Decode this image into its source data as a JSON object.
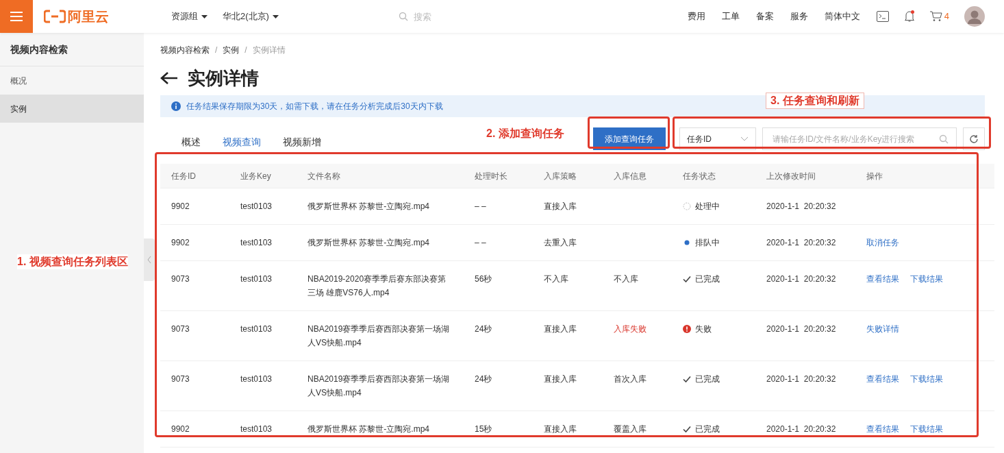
{
  "topbar": {
    "brand": "阿里云",
    "menus": [
      {
        "label": "资源组"
      },
      {
        "label": "华北2(北京)"
      }
    ],
    "search": {
      "placeholder": "搜索"
    },
    "links": [
      "费用",
      "工单",
      "备案",
      "服务",
      "简体中文"
    ],
    "notification_dot": true,
    "cart_count": "4"
  },
  "sidebar": {
    "title": "视频内容检索",
    "items": [
      {
        "label": "概况",
        "selected": false
      },
      {
        "label": "实例",
        "selected": true
      }
    ]
  },
  "breadcrumb": [
    "视频内容检索",
    "实例",
    "实例详情"
  ],
  "breadcrumb_separator": "/",
  "page_title": "实例详情",
  "notice": "任务结果保存期限为30天，如需下载，请在任务分析完成后30天内下载",
  "tabs": [
    {
      "label": "概述",
      "selected": false
    },
    {
      "label": "视频查询",
      "selected": true
    },
    {
      "label": "视频新增",
      "selected": false
    }
  ],
  "add_button": "添加查询任务",
  "filter_select": "任务ID",
  "search_field": {
    "placeholder": "请输任务ID/文件名称/业务Key进行搜索"
  },
  "table": {
    "columns": [
      "任务ID",
      "业务Key",
      "文件名称",
      "处理时长",
      "入库策略",
      "入库信息",
      "任务状态",
      "上次修改时间",
      "操作"
    ],
    "rows": [
      {
        "id": "9902",
        "key": "test0103",
        "file": "俄罗斯世界杯 苏黎世-立陶宛.mp4",
        "duration": "– –",
        "policy": "直接入库",
        "status": {
          "kind": "processing",
          "label": "处理中"
        },
        "modified": "2020-1-1  20:20:32"
      },
      {
        "id": "9902",
        "key": "test0103",
        "file": "俄罗斯世界杯 苏黎世-立陶宛.mp4",
        "duration": "– –",
        "policy": "去重入库",
        "status": {
          "kind": "queued",
          "label": "排队中"
        },
        "modified": "2020-1-1  20:20:32",
        "actions": [
          "取消任务"
        ]
      },
      {
        "id": "9073",
        "key": "test0103",
        "file": "NBA2019-2020赛季季后赛东部决赛第三场 雄鹿VS76人.mp4",
        "duration": "56秒",
        "policy": "不入库",
        "info": {
          "text": "不入库",
          "failed": false
        },
        "status": {
          "kind": "done",
          "label": "已完成"
        },
        "modified": "2020-1-1  20:20:32",
        "actions": [
          "查看结果",
          "下载结果"
        ]
      },
      {
        "id": "9073",
        "key": "test0103",
        "file": "NBA2019赛季季后赛西部决赛第一场湖人VS快船.mp4",
        "duration": "24秒",
        "policy": "直接入库",
        "info": {
          "text": "入库失败",
          "failed": true
        },
        "status": {
          "kind": "failed",
          "label": "失败"
        },
        "modified": "2020-1-1  20:20:32",
        "actions": [
          "失败详情"
        ]
      },
      {
        "id": "9073",
        "key": "test0103",
        "file": "NBA2019赛季季后赛西部决赛第一场湖人VS快船.mp4",
        "duration": "24秒",
        "policy": "直接入库",
        "info": {
          "text": "首次入库",
          "failed": false
        },
        "status": {
          "kind": "done",
          "label": "已完成"
        },
        "modified": "2020-1-1  20:20:32",
        "actions": [
          "查看结果",
          "下载结果"
        ]
      },
      {
        "id": "9902",
        "key": "test0103",
        "file": "俄罗斯世界杯 苏黎世-立陶宛.mp4",
        "duration": "15秒",
        "policy": "直接入库",
        "info": {
          "text": "覆盖入库",
          "failed": false
        },
        "status": {
          "kind": "done",
          "label": "已完成"
        },
        "modified": "2020-1-1  20:20:32",
        "actions": [
          "查看结果",
          "下载结果"
        ]
      }
    ]
  },
  "annotations": [
    "1. 视频查询任务列表区",
    "2. 添加查询任务",
    "3. 任务查询和刷新"
  ]
}
